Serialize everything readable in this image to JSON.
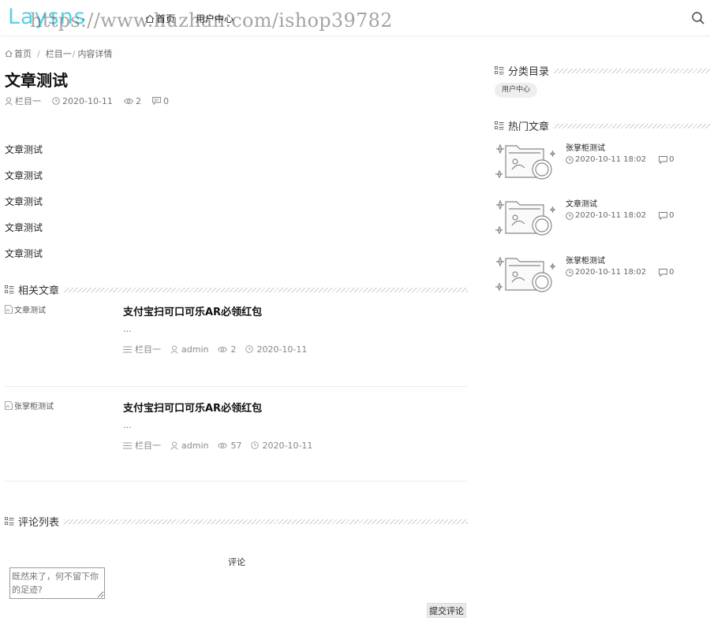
{
  "header": {
    "logo": "Laysns",
    "watermark": "https://www.huzhan.com/ishop39782",
    "nav": [
      {
        "label": "首页"
      },
      {
        "label": "用户中心"
      }
    ]
  },
  "breadcrumb": {
    "home": "首页",
    "category": "栏目一",
    "current": "内容详情"
  },
  "article": {
    "title": "文章测试",
    "category": "栏目一",
    "date": "2020-10-11",
    "views": "2",
    "comments": "0",
    "paragraphs": [
      "文章测试",
      "文章测试",
      "文章测试",
      "文章测试",
      "文章测试"
    ]
  },
  "related": {
    "title": "相关文章",
    "items": [
      {
        "img_alt": "文章测试",
        "title": "支付宝扫可口可乐AR必领红包",
        "excerpt": "...",
        "category": "栏目一",
        "author": "admin",
        "views": "2",
        "date": "2020-10-11"
      },
      {
        "img_alt": "张掌柜测试",
        "title": "支付宝扫可口可乐AR必领红包",
        "excerpt": "...",
        "category": "栏目一",
        "author": "admin",
        "views": "57",
        "date": "2020-10-11"
      }
    ]
  },
  "comments": {
    "title": "评论列表",
    "label": "评论",
    "placeholder": "既然来了，何不留下你的足迹?",
    "submit": "提交评论"
  },
  "sidebar": {
    "categories_title": "分类目录",
    "tags": [
      "用户中心"
    ],
    "hot_title": "热门文章",
    "hot": [
      {
        "title": "张掌柜测试",
        "date": "2020-10-11 18:02",
        "comments": "0"
      },
      {
        "title": "文章测试",
        "date": "2020-10-11 18:02",
        "comments": "0"
      },
      {
        "title": "张掌柜测试",
        "date": "2020-10-11 18:02",
        "comments": "0"
      }
    ]
  },
  "icons": {
    "home": "home-icon",
    "search": "search-icon",
    "user": "user-icon",
    "clock": "clock-icon",
    "eye": "eye-icon",
    "comment": "comment-icon",
    "list": "list-icon",
    "section": "section-icon",
    "thumbnail": "image-placeholder-icon",
    "broken_image": "broken-image-icon"
  },
  "colors": {
    "logo": "#5ad0e6",
    "tag_bg": "#eeeeee",
    "text": "#333333"
  }
}
